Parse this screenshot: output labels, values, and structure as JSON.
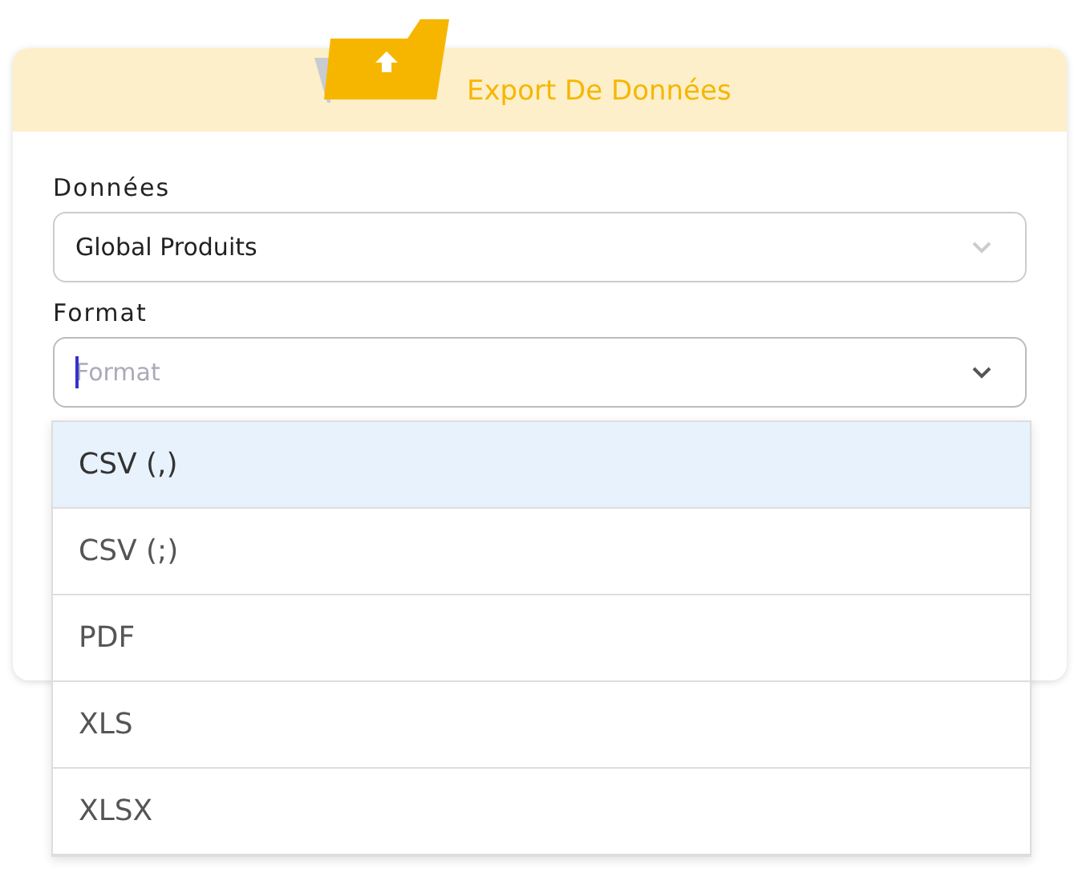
{
  "card": {
    "title": "Export De Données"
  },
  "fields": [
    {
      "label": "Données",
      "value": "Global Produits",
      "focused": false
    },
    {
      "label": "Format",
      "placeholder": "Format",
      "focused": true
    }
  ],
  "dropdown": {
    "options": [
      {
        "label": "CSV (,)",
        "selected": true
      },
      {
        "label": "CSV (;)",
        "selected": false
      },
      {
        "label": "PDF",
        "selected": false
      },
      {
        "label": "XLS",
        "selected": false
      },
      {
        "label": "XLSX",
        "selected": false
      }
    ]
  }
}
